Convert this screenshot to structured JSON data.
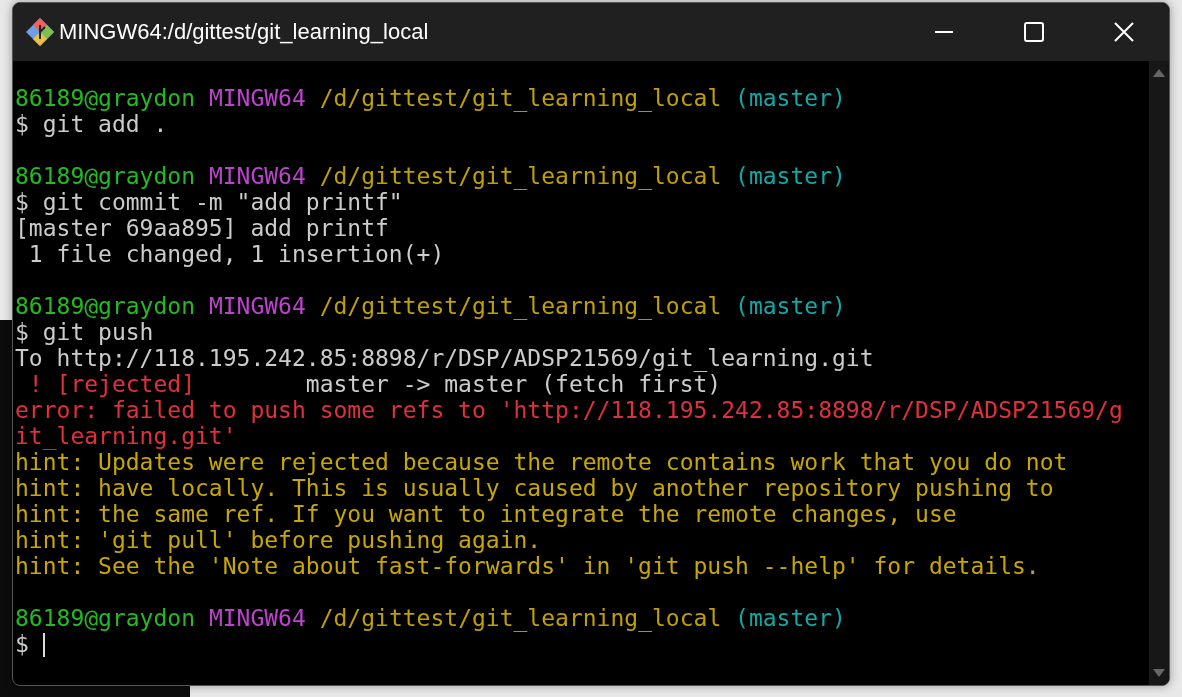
{
  "window": {
    "title": "MINGW64:/d/gittest/git_learning_local"
  },
  "terminal": {
    "cursor": true,
    "blocks": [
      {
        "lines": [
          [
            {
              "text": "86189@graydon ",
              "color": "#22bb22"
            },
            {
              "text": "MINGW64 ",
              "color": "#bb44cc"
            },
            {
              "text": "/d/gittest/git_learning_local ",
              "color": "#c0a000"
            },
            {
              "text": "(master)",
              "color": "#11a8a8"
            }
          ],
          [
            {
              "text": "$ git add .",
              "color": "#cccccc"
            }
          ]
        ]
      },
      {
        "lines": [
          [
            {
              "text": "86189@graydon ",
              "color": "#22bb22"
            },
            {
              "text": "MINGW64 ",
              "color": "#bb44cc"
            },
            {
              "text": "/d/gittest/git_learning_local ",
              "color": "#c0a000"
            },
            {
              "text": "(master)",
              "color": "#11a8a8"
            }
          ],
          [
            {
              "text": "$ git commit -m \"add printf\"",
              "color": "#cccccc"
            }
          ],
          [
            {
              "text": "[master 69aa895] add printf",
              "color": "#cccccc"
            }
          ],
          [
            {
              "text": " 1 file changed, 1 insertion(+)",
              "color": "#cccccc"
            }
          ]
        ]
      },
      {
        "lines": [
          [
            {
              "text": "86189@graydon ",
              "color": "#22bb22"
            },
            {
              "text": "MINGW64 ",
              "color": "#bb44cc"
            },
            {
              "text": "/d/gittest/git_learning_local ",
              "color": "#c0a000"
            },
            {
              "text": "(master)",
              "color": "#11a8a8"
            }
          ],
          [
            {
              "text": "$ git push",
              "color": "#cccccc"
            }
          ],
          [
            {
              "text": "To http://118.195.242.85:8898/r/DSP/ADSP21569/git_learning.git",
              "color": "#cccccc"
            }
          ],
          [
            {
              "text": " ! [rejected]        ",
              "color": "#e0303c"
            },
            {
              "text": "master -> master (fetch first)",
              "color": "#cccccc"
            }
          ],
          [
            {
              "text": "error: failed to push some refs to 'http://118.195.242.85:8898/r/DSP/ADSP21569/g",
              "color": "#e0303c"
            }
          ],
          [
            {
              "text": "it_learning.git'",
              "color": "#e0303c"
            }
          ],
          [
            {
              "text": "hint: Updates were rejected because the remote contains work that you do not",
              "color": "#c8a800"
            }
          ],
          [
            {
              "text": "hint: have locally. This is usually caused by another repository pushing to",
              "color": "#c8a800"
            }
          ],
          [
            {
              "text": "hint: the same ref. If you want to integrate the remote changes, use",
              "color": "#c8a800"
            }
          ],
          [
            {
              "text": "hint: 'git pull' before pushing again.",
              "color": "#c8a800"
            }
          ],
          [
            {
              "text": "hint: See the 'Note about fast-forwards' in 'git push --help' for details.",
              "color": "#c8a800"
            }
          ]
        ]
      },
      {
        "lines": [
          [
            {
              "text": "86189@graydon ",
              "color": "#22bb22"
            },
            {
              "text": "MINGW64 ",
              "color": "#bb44cc"
            },
            {
              "text": "/d/gittest/git_learning_local ",
              "color": "#c0a000"
            },
            {
              "text": "(master)",
              "color": "#11a8a8"
            }
          ],
          [
            {
              "text": "$ ",
              "color": "#cccccc"
            }
          ]
        ]
      }
    ]
  }
}
